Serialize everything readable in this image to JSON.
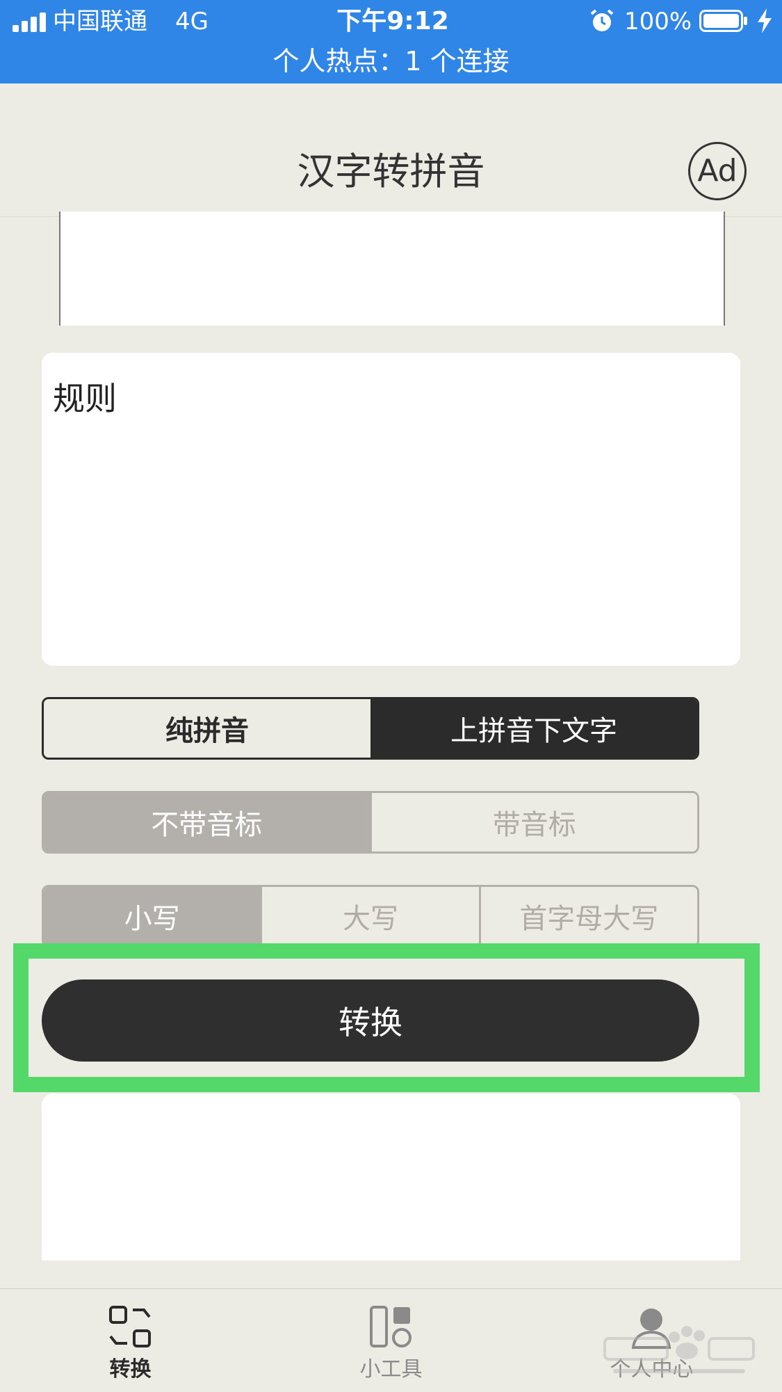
{
  "status_bar": {
    "carrier": "中国联通",
    "network": "4G",
    "time": "下午9:12",
    "battery": "100%",
    "hotspot": "个人热点：1 个连接"
  },
  "nav": {
    "title": "汉字转拼音",
    "ad_label": "Ad"
  },
  "input": {
    "text": "规则"
  },
  "display_mode": {
    "options": [
      "纯拼音",
      "上拼音下文字"
    ],
    "selected": "上拼音下文字"
  },
  "tone_mode": {
    "options": [
      "不带音标",
      "带音标"
    ],
    "selected": "不带音标"
  },
  "case_mode": {
    "options": [
      "小写",
      "大写",
      "首字母大写"
    ],
    "selected": "小写"
  },
  "convert_button": {
    "label": "转换"
  },
  "tab_bar": {
    "items": [
      {
        "label": "转换",
        "icon": "convert-icon",
        "active": true
      },
      {
        "label": "小工具",
        "icon": "tools-icon",
        "active": false
      },
      {
        "label": "个人中心",
        "icon": "profile-icon",
        "active": false
      }
    ]
  },
  "colors": {
    "status_bar": "#2f86e6",
    "background": "#ecebe4",
    "dark": "#2b2b2b",
    "muted": "#b3b0ab",
    "highlight": "#54d86a"
  }
}
